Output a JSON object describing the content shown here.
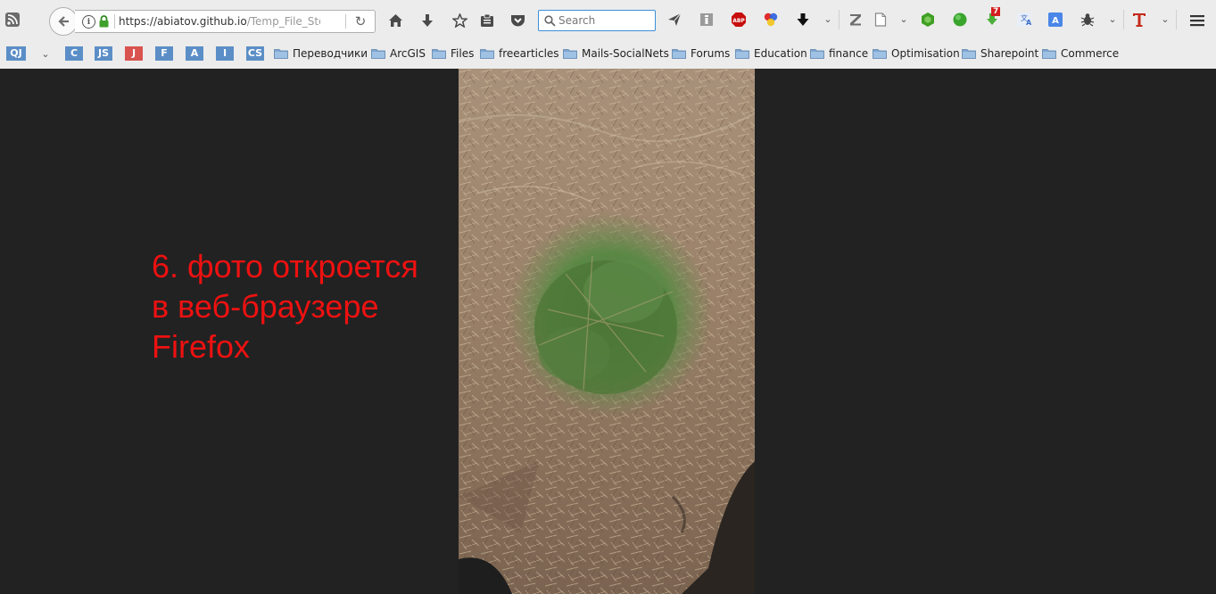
{
  "navbar": {
    "url_host": "https://abiatov.github.io",
    "url_path": "/Temp_File_Store/",
    "search_placeholder": "Search",
    "badge_count": "7",
    "abp_label": "ABP"
  },
  "bookmarks": {
    "chips": [
      {
        "label": "QJ",
        "color": "#5b8ec7"
      },
      {
        "label": "C",
        "color": "#5b8ec7"
      },
      {
        "label": "JS",
        "color": "#5b8ec7"
      },
      {
        "label": "J",
        "color": "#d9534f"
      },
      {
        "label": "F",
        "color": "#5b8ec7"
      },
      {
        "label": "A",
        "color": "#5b8ec7"
      },
      {
        "label": "I",
        "color": "#5b8ec7"
      },
      {
        "label": "CS",
        "color": "#5b8ec7"
      }
    ],
    "folders": [
      "Переводчики",
      "ArcGIS",
      "Files",
      "freearticles",
      "Mails-SocialNets",
      "Forums",
      "Education",
      "finance",
      "Optimisation",
      "Sharepoint",
      "Commerce"
    ]
  },
  "page": {
    "caption_line1": "6. фото откроется",
    "caption_line2": "в веб-браузере",
    "caption_line3": "Firefox"
  },
  "colors": {
    "page_bg": "#222222",
    "caption": "#ee1111",
    "folder": "#7ea6d0"
  }
}
